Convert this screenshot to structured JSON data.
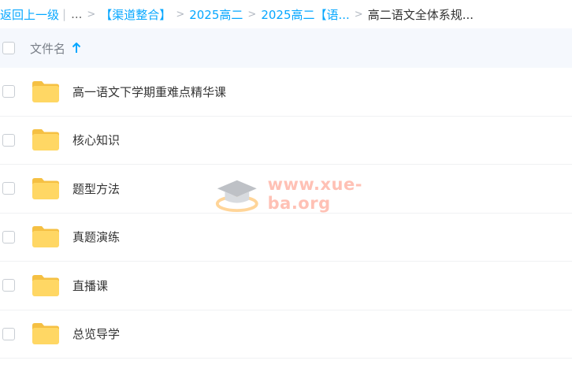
{
  "breadcrumb": {
    "back": "返回上一级",
    "bar": "|",
    "ellipsis": "...",
    "sep": ">",
    "items": [
      "【渠道整合】",
      "2025高二",
      "2025高二【语...",
      "高二语文全体系规..."
    ]
  },
  "header": {
    "name_label": "文件名",
    "sort": "ascending"
  },
  "files": [
    {
      "name": "高一语文下学期重难点精华课",
      "type": "folder"
    },
    {
      "name": "核心知识",
      "type": "folder"
    },
    {
      "name": "题型方法",
      "type": "folder"
    },
    {
      "name": "真题演练",
      "type": "folder"
    },
    {
      "name": "直播课",
      "type": "folder"
    },
    {
      "name": "总览导学",
      "type": "folder"
    }
  ],
  "watermark": {
    "text": "www.xue-ba.org"
  },
  "colors": {
    "link": "#06a7ff",
    "folder": "#ffd764",
    "header_bg": "#f5f8fd"
  }
}
